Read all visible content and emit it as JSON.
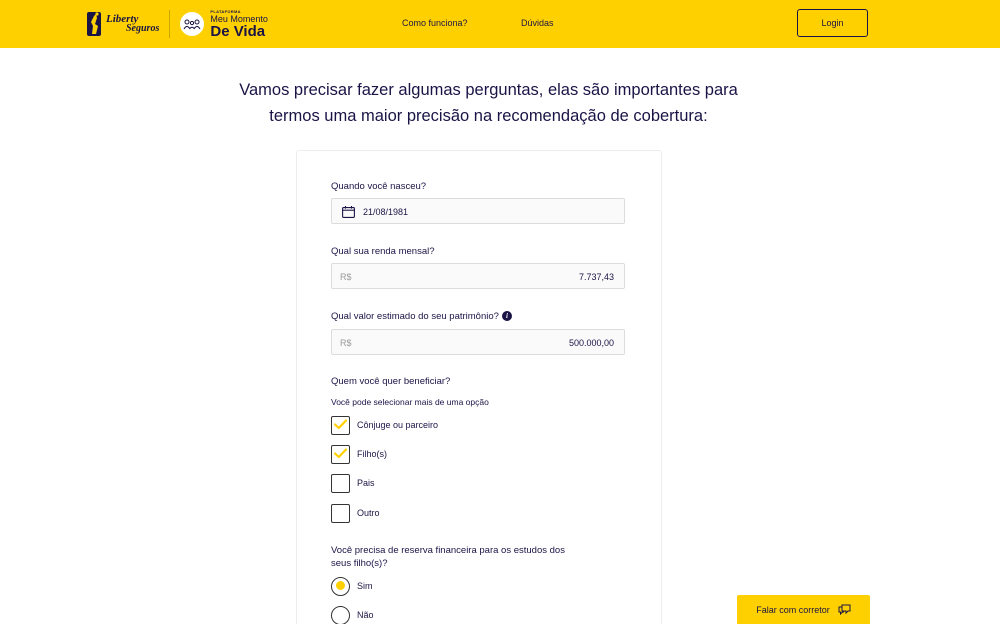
{
  "header": {
    "liberty_line1": "Liberty",
    "liberty_line2": "Seguros",
    "mmdv_tag": "PLATAFORMA",
    "mmdv_line1": "Meu Momento",
    "mmdv_line2": "De Vida",
    "nav": [
      "Como funciona?",
      "Dúvidas"
    ],
    "login_label": "Login"
  },
  "intro": {
    "line1": "Vamos precisar fazer algumas perguntas, elas são importantes para",
    "line2": "termos uma maior precisão na recomendação de cobertura:"
  },
  "form": {
    "birth": {
      "label": "Quando você nasceu?",
      "value": "21/08/1981"
    },
    "income": {
      "label": "Qual sua renda mensal?",
      "prefix": "R$",
      "value": "7.737,43"
    },
    "assets": {
      "label": "Qual valor estimado do seu patrimônio?",
      "prefix": "R$",
      "value": "500.000,00"
    },
    "beneficiaries": {
      "label": "Quem você quer beneficiar?",
      "sub": "Você pode selecionar mais de uma opção",
      "options": [
        {
          "label": "Cônjuge ou parceiro",
          "checked": true
        },
        {
          "label": "Filho(s)",
          "checked": true
        },
        {
          "label": "Pais",
          "checked": false
        },
        {
          "label": "Outro",
          "checked": false
        }
      ]
    },
    "reserve": {
      "label_line1": "Você precisa de reserva financeira para os estudos dos",
      "label_line2": "seus filho(s)?",
      "options": [
        {
          "label": "Sim",
          "selected": true
        },
        {
          "label": "Não",
          "selected": false
        }
      ]
    }
  },
  "falar_label": "Falar com corretor",
  "colors": {
    "brand_yellow": "#ffd000",
    "navy": "#1a1446"
  }
}
